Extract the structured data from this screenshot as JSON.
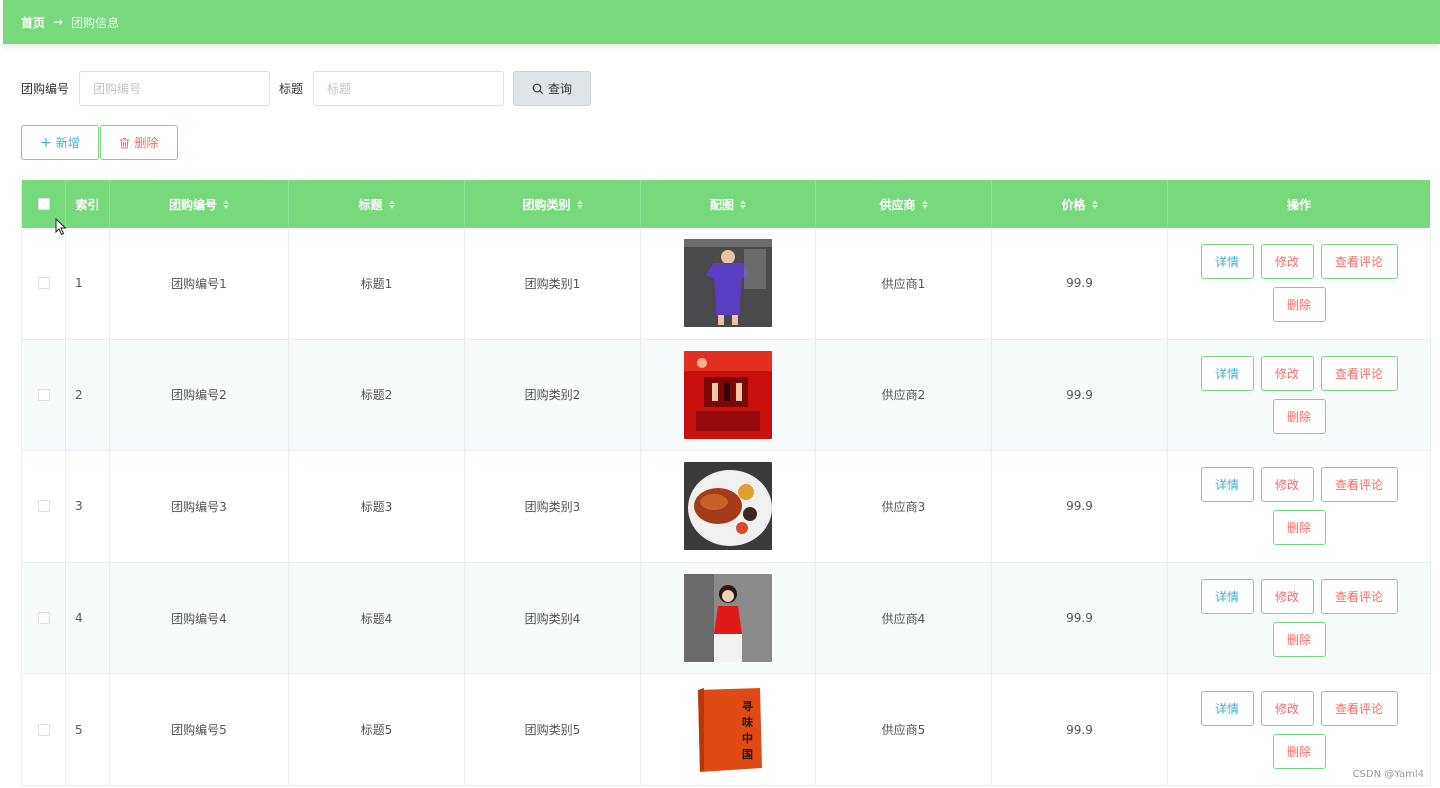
{
  "breadcrumb": {
    "home": "首页",
    "separator": "→",
    "current": "团购信息"
  },
  "search": {
    "fields": [
      {
        "label": "团购编号",
        "placeholder": "团购编号"
      },
      {
        "label": "标题",
        "placeholder": "标题"
      }
    ],
    "query_label": "查询"
  },
  "actions": {
    "add_label": "新增",
    "delete_label": "删除"
  },
  "table": {
    "columns": [
      "索引",
      "团购编号",
      "标题",
      "团购类别",
      "配图",
      "供应商",
      "价格",
      "操作"
    ],
    "rows": [
      {
        "index": "1",
        "code": "团购编号1",
        "title": "标题1",
        "category": "团购类别1",
        "image": "purple-outfit-photo",
        "supplier": "供应商1",
        "price": "99.9"
      },
      {
        "index": "2",
        "code": "团购编号2",
        "title": "标题2",
        "category": "团购类别2",
        "image": "red-interior-photo",
        "supplier": "供应商2",
        "price": "99.9"
      },
      {
        "index": "3",
        "code": "团购编号3",
        "title": "标题3",
        "category": "团购类别3",
        "image": "food-plate-photo",
        "supplier": "供应商3",
        "price": "99.9"
      },
      {
        "index": "4",
        "code": "团购编号4",
        "title": "标题4",
        "category": "团购类别4",
        "image": "red-dress-photo",
        "supplier": "供应商4",
        "price": "99.9"
      },
      {
        "index": "5",
        "code": "团购编号5",
        "title": "标题5",
        "category": "团购类别5",
        "image": "orange-book-photo",
        "supplier": "供应商5",
        "price": "99.9"
      }
    ],
    "row_actions": {
      "detail": "详情",
      "edit": "修改",
      "review": "查看评论",
      "delete": "删除"
    }
  },
  "watermark": "CSDN @Yaml4",
  "colors": {
    "accent": "#78d97c",
    "info_text": "#3fb4c4",
    "danger_text": "#f56c6c"
  }
}
